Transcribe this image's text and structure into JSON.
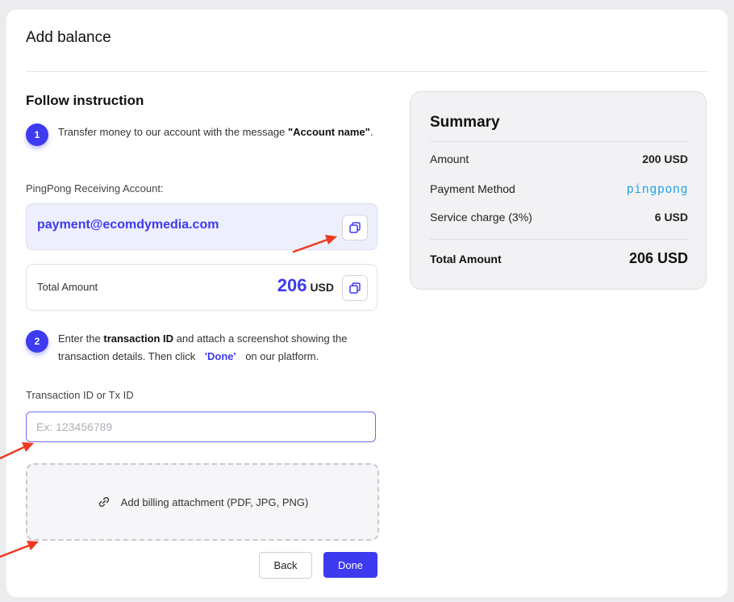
{
  "dialog": {
    "title": "Add balance"
  },
  "instructions": {
    "title": "Follow instruction",
    "step1": {
      "number": "1",
      "text_before": "Transfer money to our account with the message ",
      "text_bold": "\"Account name\"",
      "text_after": "."
    },
    "account": {
      "label": "PingPong Receiving Account:",
      "email": "payment@ecomdymedia.com"
    },
    "total": {
      "label": "Total Amount",
      "value": "206",
      "currency": "USD"
    },
    "step2": {
      "number": "2",
      "text_before": "Enter the ",
      "text_bold": "transaction ID",
      "text_middle": " and attach a screenshot showing the transaction details. Then click ",
      "done_ref": "'Done'",
      "text_after": " on our platform."
    },
    "transaction": {
      "label": "Transaction ID or Tx ID",
      "placeholder": "Ex: 123456789",
      "value": ""
    },
    "attachment": {
      "label": "Add billing attachment (PDF, JPG, PNG)"
    },
    "buttons": {
      "back": "Back",
      "done": "Done"
    }
  },
  "summary": {
    "title": "Summary",
    "rows": [
      {
        "label": "Amount",
        "value": "200 USD"
      },
      {
        "label": "Payment Method",
        "value": "pingpong"
      },
      {
        "label": "Service charge (3%)",
        "value": "6 USD"
      }
    ],
    "total_label": "Total Amount",
    "total_value": "206 USD"
  },
  "icons": {
    "copy": "copy-icon",
    "link": "link-icon",
    "annotation_arrow": "arrow-icon"
  },
  "colors": {
    "accent": "#3d3af0",
    "annotation": "#ee3a22",
    "pingpong_brand": "#29a3e8"
  }
}
